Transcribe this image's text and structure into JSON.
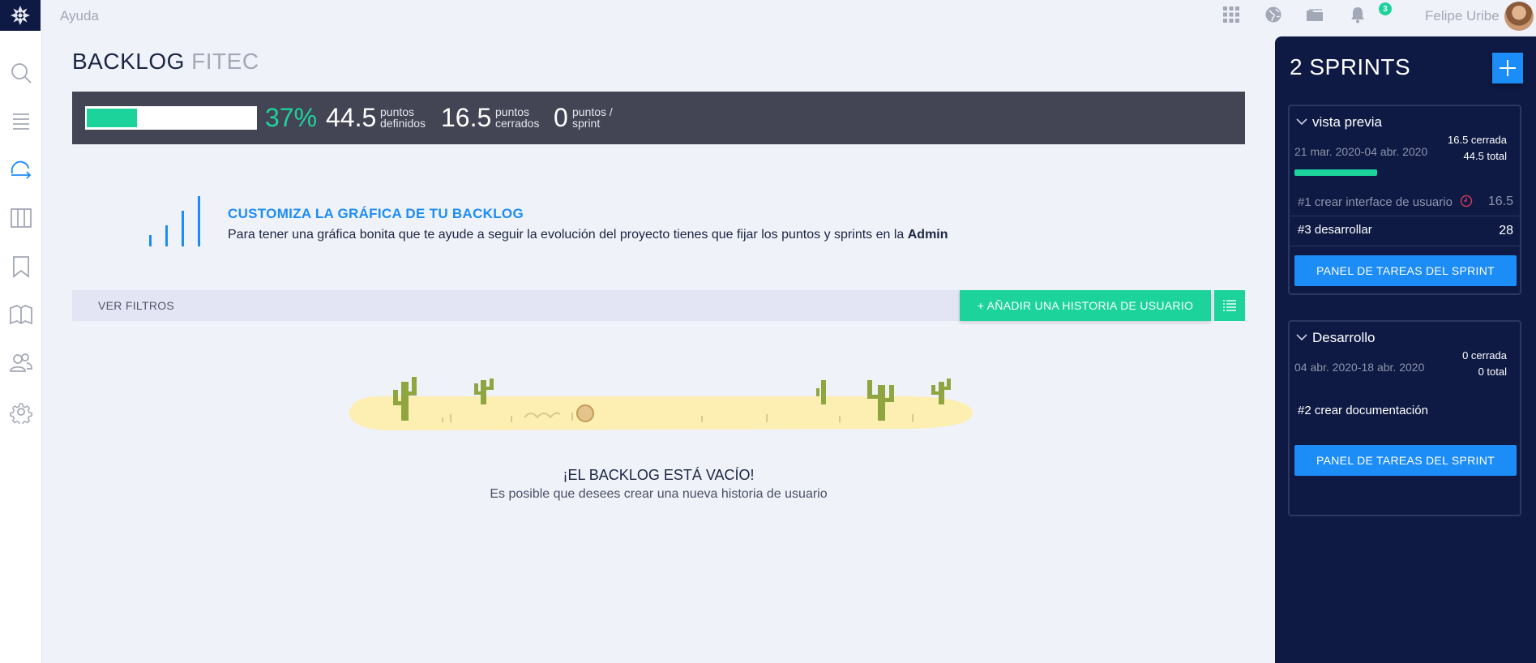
{
  "topbar": {
    "help": "Ayuda",
    "notifications_count": "3",
    "user_name": "Felipe Uribe",
    "icons": [
      "apps-grid-icon",
      "globe-icon",
      "folder-icon",
      "bell-icon"
    ]
  },
  "nav": {
    "icons": [
      "search-icon",
      "list-icon",
      "backlog-icon",
      "kanban-icon",
      "bookmark-icon",
      "wiki-book-icon",
      "team-icon",
      "settings-icon"
    ],
    "active": "backlog-icon"
  },
  "header": {
    "title": "BACKLOG",
    "project": "FITEC"
  },
  "summary": {
    "progress_percent": 37,
    "percent_label": "37%",
    "defined_points": "44.5",
    "defined_label_1": "puntos",
    "defined_label_2": "definidos",
    "closed_points": "16.5",
    "closed_label_1": "puntos",
    "closed_label_2": "cerrados",
    "sprint_points": "0",
    "sprint_label_1": "puntos /",
    "sprint_label_2": "sprint"
  },
  "graph_cta": {
    "title": "CUSTOMIZA LA GRÁFICA DE TU BACKLOG",
    "text": "Para tener una gráfica bonita que te ayude a seguir la evolución del proyecto tienes que fijar los puntos y sprints en la ",
    "link": "Admin"
  },
  "filters": {
    "label": "VER FILTROS",
    "add_us": "+ AÑADIR UNA HISTORIA DE USUARIO"
  },
  "empty": {
    "title": "¡EL BACKLOG ESTÁ VACÍO!",
    "subtitle": "Es posible que desees crear una nueva historia de usuario"
  },
  "sprints": {
    "title": "2 SPRINTS",
    "items": [
      {
        "name": "vista previa",
        "closed": "16.5 cerrada",
        "total": "44.5 total",
        "dates": "21 mar. 2020-04 abr. 2020",
        "progress_fraction": 0.37,
        "stories": [
          {
            "ref": "#1 crear interface de usuario",
            "points": "16.5",
            "closed": true
          },
          {
            "ref": "#3 desarrollar",
            "points": "28",
            "closed": false
          }
        ],
        "button": "PANEL DE TAREAS DEL SPRINT"
      },
      {
        "name": "Desarrollo",
        "closed": "0 cerrada",
        "total": "0 total",
        "dates": "04 abr. 2020-18 abr. 2020",
        "stories": [
          {
            "ref": "#2 crear documentación",
            "points": "",
            "closed": false
          }
        ],
        "button": "PANEL DE TAREAS DEL SPRINT"
      }
    ]
  },
  "colors": {
    "accent_green": "#1dd39c",
    "accent_blue": "#1c8cf7",
    "navy": "#0e1a44",
    "summary_bg": "#434454"
  }
}
